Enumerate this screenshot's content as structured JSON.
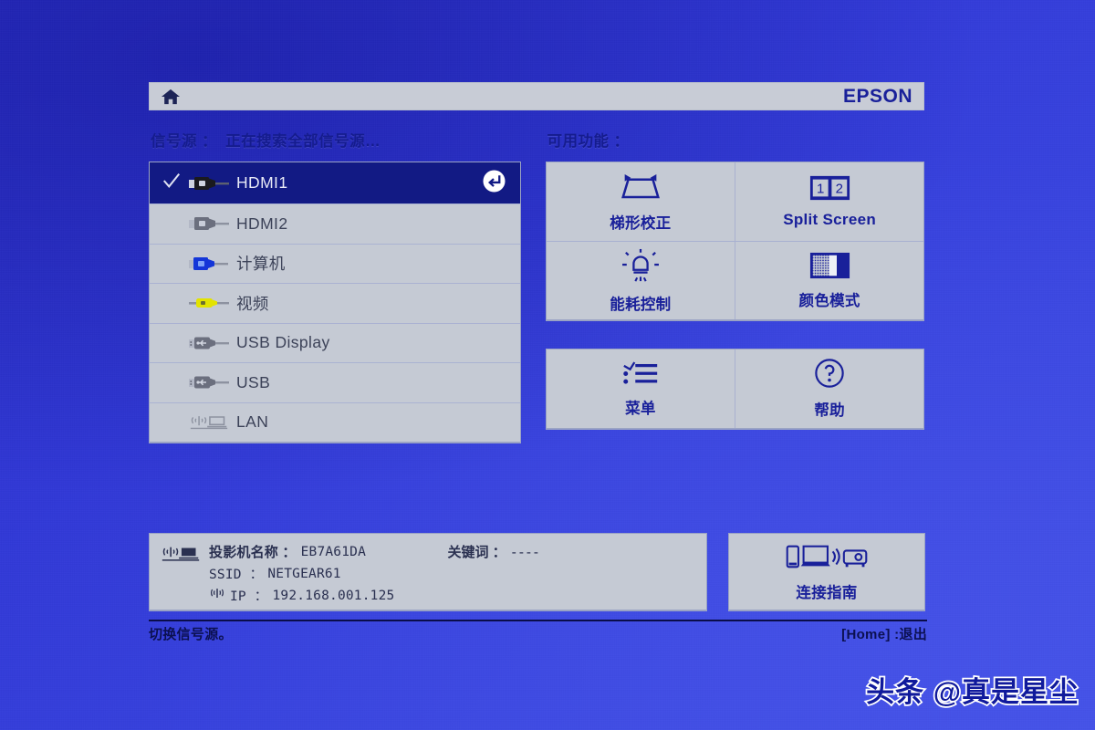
{
  "device": {
    "brand": "EPSON",
    "home_icon": "home-icon"
  },
  "sources": {
    "label": "信号源 ：",
    "status": "正在搜索全部信号源…",
    "items": [
      {
        "label": "HDMI1",
        "icon": "hdmi-connector-icon",
        "selected": true,
        "checked": true,
        "enter": "enter-icon"
      },
      {
        "label": "HDMI2",
        "icon": "hdmi-connector-icon",
        "selected": false,
        "checked": false
      },
      {
        "label": "计算机",
        "icon": "vga-connector-icon",
        "selected": false,
        "checked": false
      },
      {
        "label": "视频",
        "icon": "rca-video-connector-icon",
        "selected": false,
        "checked": false
      },
      {
        "label": "USB Display",
        "icon": "usb-connector-icon",
        "selected": false,
        "checked": false
      },
      {
        "label": "USB",
        "icon": "usb-connector-icon",
        "selected": false,
        "checked": false
      },
      {
        "label": "LAN",
        "icon": "lan-wireless-icon",
        "selected": false,
        "checked": false
      }
    ]
  },
  "functions": {
    "label": "可用功能 ：",
    "primary": [
      {
        "label": "梯形校正",
        "icon": "keystone-icon",
        "latin": false
      },
      {
        "label": "Split Screen",
        "icon": "split-screen-icon",
        "latin": true
      },
      {
        "label": "能耗控制",
        "icon": "brightness-icon",
        "latin": false
      },
      {
        "label": "颜色模式",
        "icon": "color-mode-icon",
        "latin": false
      }
    ],
    "secondary": [
      {
        "label": "菜单",
        "icon": "menu-list-icon",
        "latin": false
      },
      {
        "label": "帮助",
        "icon": "help-question-icon",
        "latin": false
      }
    ]
  },
  "network_info": {
    "icon": "lan-wireless-icon",
    "projector_name_label": "投影机名称 ：",
    "projector_name_value": "EB7A61DA",
    "ssid_label": "SSID  ：",
    "ssid_value": "NETGEAR61",
    "ip_icon": "wifi-signal-icon",
    "ip_label": "IP ：",
    "ip_value": "192.168.001.125",
    "keyword_label": "关键词 ：",
    "keyword_value": "----"
  },
  "connection_guide": {
    "label": "连接指南",
    "icon": "connection-guide-icon"
  },
  "footer": {
    "hint": "切换信号源。",
    "exit": "[Home] :退出"
  },
  "watermark": {
    "text": "头条 @真是星尘"
  },
  "colors": {
    "osd_panel": "#c5cad4",
    "osd_header": "#c8ccd6",
    "accent_dark_blue": "#19209a",
    "selected_row": "#121a84",
    "background_blue": "#3139d6"
  }
}
